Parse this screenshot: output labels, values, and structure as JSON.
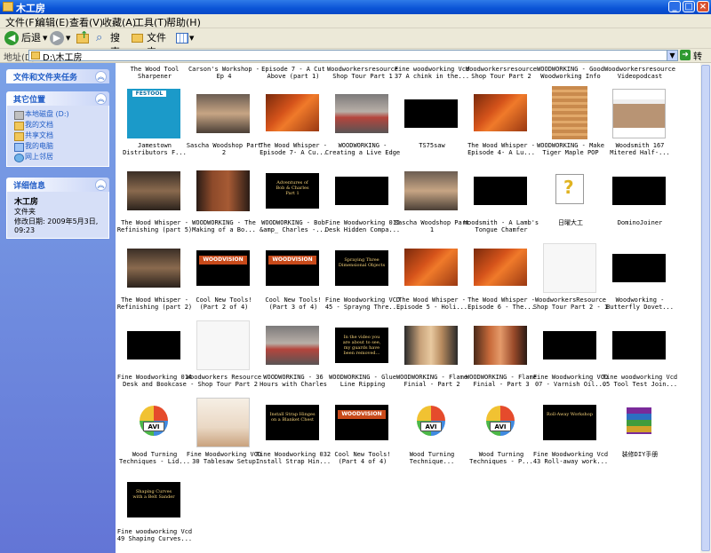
{
  "window": {
    "title": "木工房"
  },
  "menu": [
    "文件(F)",
    "编辑(E)",
    "查看(V)",
    "收藏(A)",
    "工具(T)",
    "帮助(H)"
  ],
  "toolbar": {
    "back": "后退",
    "search": "搜索",
    "folders": "文件夹"
  },
  "address": {
    "label": "地址(D)",
    "value": "D:\\木工房",
    "go": "转到"
  },
  "sidebar": {
    "tasks_title": "文件和文件夹任务",
    "other_title": "其它位置",
    "other_links": [
      "本地磁盘 (D:)",
      "我的文档",
      "共享文档",
      "我的电脑",
      "网上邻居"
    ],
    "details_title": "详细信息",
    "details_name": "木工房",
    "details_type": "文件夹",
    "details_modified": "修改日期: 2009年5月3日, 09:23"
  },
  "top_labels": [
    "The Wood Tool\nSharpener",
    "Carson's Workshop -\nEp 4",
    "Episode 7 - A Cut\nAbove (part 1)",
    "Woodworkersresource\nShop Tour Part 1",
    "Fine woodworking Vcd\n37 A chink in the...",
    "Woodworkersresource\nShop Tour Part 2",
    "WOODWORKING - Good\nWoodworking Info",
    "Woodworkersresource\nVideopodcast"
  ],
  "items": [
    {
      "label": "Jamestown\nDistributors F...",
      "kind": "festool",
      "text": "FESTOOL"
    },
    {
      "label": "Sascha Woodshop Part\n2",
      "kind": "workshop"
    },
    {
      "label": "The Wood Whisper -\nEpisode 7- A Cu...",
      "kind": "wood"
    },
    {
      "label": "WOODWORKING -\nCreating a Live Edge",
      "kind": "person"
    },
    {
      "label": "TS75saw",
      "kind": "black"
    },
    {
      "label": "The Wood Whisper -\nEpisode 4- A Lu...",
      "kind": "wood"
    },
    {
      "label": "WOODWORKING - Make\nTiger Maple POP",
      "kind": "maple"
    },
    {
      "label": "Woodsmith 167\nMitered Half-...",
      "kind": "screen"
    },
    {
      "label": "The Wood Whisper -\nRefinishing (part 5)",
      "kind": "shop"
    },
    {
      "label": "WOODWORKING - The\nMaking of a Bo...",
      "kind": "cabinet"
    },
    {
      "label": "WOODWORKING - Bob\n&amp_ Charles -...",
      "kind": "title",
      "text": "Adventures of\nBob & Charles\nPart 1"
    },
    {
      "label": "Fine Woodworking 015\nDesk Hidden Compa...",
      "kind": "black"
    },
    {
      "label": "Sascha Woodshop Part\n1",
      "kind": "workshop"
    },
    {
      "label": "Woodsmith - A Lamb's\nTongue Chamfer",
      "kind": "black"
    },
    {
      "label": "日曜大工",
      "kind": "unknown"
    },
    {
      "label": "DominoJoiner",
      "kind": "black"
    },
    {
      "label": "The Wood Whisper -\nRefinishing (part 2)",
      "kind": "shop"
    },
    {
      "label": "Cool New Tools!\n(Part 2 of 4)",
      "kind": "logo",
      "text": "WOODVISION"
    },
    {
      "label": "Cool New Tools!\n(Part 3 of 4)",
      "kind": "logo",
      "text": "WOODVISION"
    },
    {
      "label": "Fine Woodworking VCD\n45 - Sprayng Thre...",
      "kind": "title",
      "text": "Spraying Three\nDimensional Objects"
    },
    {
      "label": "The Wood Whisper -\nEpisode 5 - Holi...",
      "kind": "wood"
    },
    {
      "label": "The Wood Whisper -\nEpisode 6 - The...",
      "kind": "wood"
    },
    {
      "label": "WoodworkersResource\nShop Tour Part 2 - 1",
      "kind": "blank"
    },
    {
      "label": "Woodworking -\nButterfly Dovet...",
      "kind": "black"
    },
    {
      "label": "Fine Woodworking 014\nDesk and Bookcase",
      "kind": "black"
    },
    {
      "label": "Woodworkers Resource\n- Shop Tour Part 2",
      "kind": "blank"
    },
    {
      "label": "WOODWORKING - 36\nHours with Charles",
      "kind": "person"
    },
    {
      "label": "WOODWORKING - Glue\nLine Ripping",
      "kind": "title",
      "text": "In the video you\nare about to see,\nmy guards have\nbeen removed..."
    },
    {
      "label": "WOODWORKING - Flame\nFinial - Part 2",
      "kind": "lathe"
    },
    {
      "label": "WOODWORKING - Flame\nFinial - Part 3",
      "kind": "lathe2"
    },
    {
      "label": "Fine Woodworking VCD\n07 - Varnish Oil...",
      "kind": "black"
    },
    {
      "label": "Fine woodworking Vcd\n05 Tool Test Join...",
      "kind": "black"
    },
    {
      "label": "Wood Turning\nTechniques - Lid...",
      "kind": "avi",
      "text": "AVI"
    },
    {
      "label": "Fine Woodworking VCD\n30 Tablesaw Setup",
      "kind": "tablesaw"
    },
    {
      "label": "Fine Woodworking 032\nInstall Strap Hin...",
      "kind": "title",
      "text": "Install Strap Hinges\non a Blanket Chest"
    },
    {
      "label": "Cool New Tools!\n(Part 4 of 4)",
      "kind": "logo",
      "text": "WOODVISION"
    },
    {
      "label": "Wood Turning\nTechnique...",
      "kind": "avi",
      "text": "AVI"
    },
    {
      "label": "Wood Turning\nTechniques - P...",
      "kind": "avi",
      "text": "AVI"
    },
    {
      "label": "Fine Woodworking Vcd\n43 Roll-away work...",
      "kind": "title",
      "text": "Roll-Away Workshop"
    },
    {
      "label": "装修DIY手册",
      "kind": "rar"
    },
    {
      "label": "Fine woodworking Vcd\n49 Shaping Curves...",
      "kind": "title",
      "text": "Shaping Curves\nwith a Belt Sander"
    }
  ]
}
